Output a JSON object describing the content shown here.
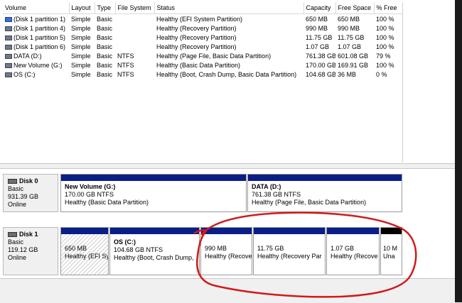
{
  "volume_table": {
    "columns": [
      "Volume",
      "Layout",
      "Type",
      "File System",
      "Status",
      "Capacity",
      "Free Space",
      "% Free"
    ],
    "rows": [
      {
        "icon": "blue",
        "volume": "(Disk 1 partition 1)",
        "layout": "Simple",
        "type": "Basic",
        "fs": "",
        "status": "Healthy (EFI System Partition)",
        "capacity": "650 MB",
        "free": "650 MB",
        "pct": "100 %"
      },
      {
        "icon": "grey",
        "volume": "(Disk 1 partition 4)",
        "layout": "Simple",
        "type": "Basic",
        "fs": "",
        "status": "Healthy (Recovery Partition)",
        "capacity": "990 MB",
        "free": "990 MB",
        "pct": "100 %"
      },
      {
        "icon": "grey",
        "volume": "(Disk 1 partition 5)",
        "layout": "Simple",
        "type": "Basic",
        "fs": "",
        "status": "Healthy (Recovery Partition)",
        "capacity": "11.75 GB",
        "free": "11.75 GB",
        "pct": "100 %"
      },
      {
        "icon": "grey",
        "volume": "(Disk 1 partition 6)",
        "layout": "Simple",
        "type": "Basic",
        "fs": "",
        "status": "Healthy (Recovery Partition)",
        "capacity": "1.07 GB",
        "free": "1.07 GB",
        "pct": "100 %"
      },
      {
        "icon": "grey",
        "volume": "DATA (D:)",
        "layout": "Simple",
        "type": "Basic",
        "fs": "NTFS",
        "status": "Healthy (Page File, Basic Data Partition)",
        "capacity": "761.38 GB",
        "free": "601.08 GB",
        "pct": "79 %"
      },
      {
        "icon": "grey",
        "volume": "New Volume (G:)",
        "layout": "Simple",
        "type": "Basic",
        "fs": "NTFS",
        "status": "Healthy (Basic Data Partition)",
        "capacity": "170.00 GB",
        "free": "169.91 GB",
        "pct": "100 %"
      },
      {
        "icon": "grey",
        "volume": "OS (C:)",
        "layout": "Simple",
        "type": "Basic",
        "fs": "NTFS",
        "status": "Healthy (Boot, Crash Dump, Basic Data Partition)",
        "capacity": "104.68 GB",
        "free": "36 MB",
        "pct": "0 %"
      }
    ]
  },
  "disk0": {
    "name": "Disk 0",
    "type": "Basic",
    "size": "931.39 GB",
    "state": "Online",
    "partitions": [
      {
        "title": "New Volume  (G:)",
        "size": "170.00 GB NTFS",
        "status": "Healthy (Basic Data Partition)"
      },
      {
        "title": "DATA  (D:)",
        "size": "761.38 GB NTFS",
        "status": "Healthy (Page File, Basic Data Partition)"
      }
    ]
  },
  "disk1": {
    "name": "Disk 1",
    "type": "Basic",
    "size": "119.12 GB",
    "state": "Online",
    "partitions": [
      {
        "title": "",
        "size": "650 MB",
        "status": "Healthy (EFI Sy"
      },
      {
        "title": "OS  (C:)",
        "size": "104.68 GB NTFS",
        "status": "Healthy (Boot, Crash Dump,"
      },
      {
        "title": "",
        "size": "990 MB",
        "status": "Healthy (Recove"
      },
      {
        "title": "",
        "size": "11.75 GB",
        "status": "Healthy (Recovery Par"
      },
      {
        "title": "",
        "size": "1.07 GB",
        "status": "Healthy (Recove"
      },
      {
        "title": "",
        "size": "10 M",
        "status": "Una"
      }
    ]
  },
  "colors": {
    "primary_bar": "#0a1e87",
    "unallocated_bar": "#000000",
    "annotation": "#d11a1a"
  }
}
